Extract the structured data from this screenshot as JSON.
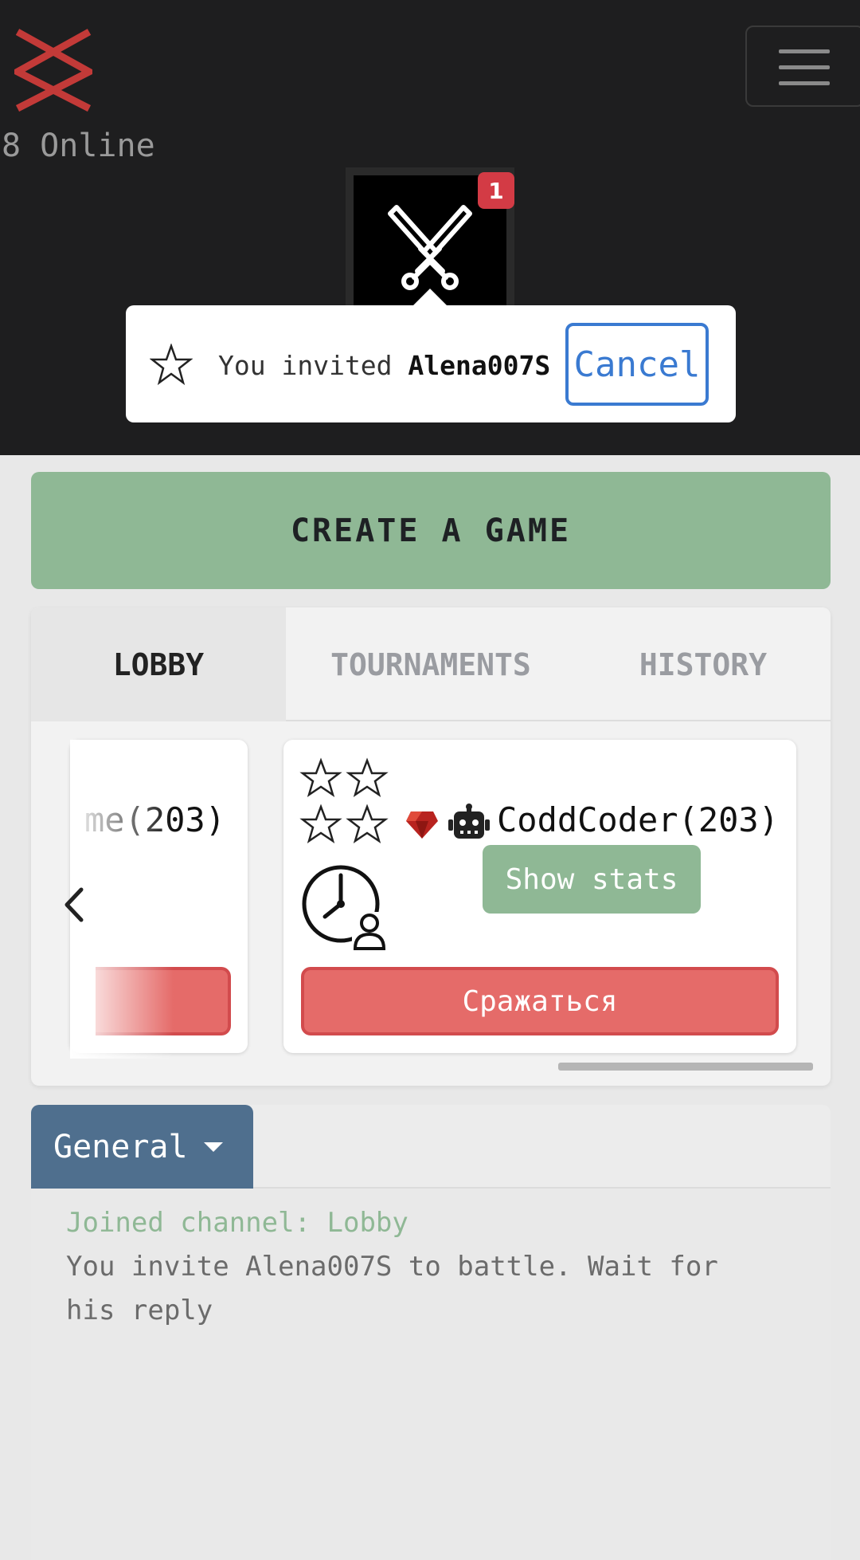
{
  "header": {
    "online_text": "8 Online",
    "notification_count": "1",
    "logo_icon": "crossed-x-logo",
    "menu_icon": "hamburger-menu-icon",
    "battle_icon": "crossed-swords-icon"
  },
  "invite_popover": {
    "prefix": "You invited ",
    "username": "Alena007S",
    "cancel_label": "Cancel"
  },
  "actions": {
    "create_game_label": "CREATE A GAME"
  },
  "tabs": [
    {
      "label": "LOBBY",
      "active": true
    },
    {
      "label": "TOURNAMENTS",
      "active": false
    },
    {
      "label": "HISTORY",
      "active": false
    }
  ],
  "games": [
    {
      "player_label": "me(203)",
      "partial": true
    },
    {
      "player_label": "CoddCoder(203)",
      "show_stats_label": "Show stats",
      "fight_label": "Сражаться",
      "lang_icon": "ruby-icon",
      "player_icon": "robot-icon",
      "difficulty_stars": 4
    }
  ],
  "chat": {
    "channel_label": "General",
    "messages": [
      {
        "text": "Joined channel: Lobby",
        "type": "system"
      },
      {
        "text": "You invite Alena007S to battle. Wait for",
        "type": "normal"
      },
      {
        "text": "his reply",
        "type": "normal"
      }
    ]
  },
  "colors": {
    "accent_green": "#8fb895",
    "danger_red": "#e56b69",
    "link_blue": "#3a7ad1",
    "channel_blue": "#4f6f8e",
    "badge_red": "#d33b45"
  }
}
